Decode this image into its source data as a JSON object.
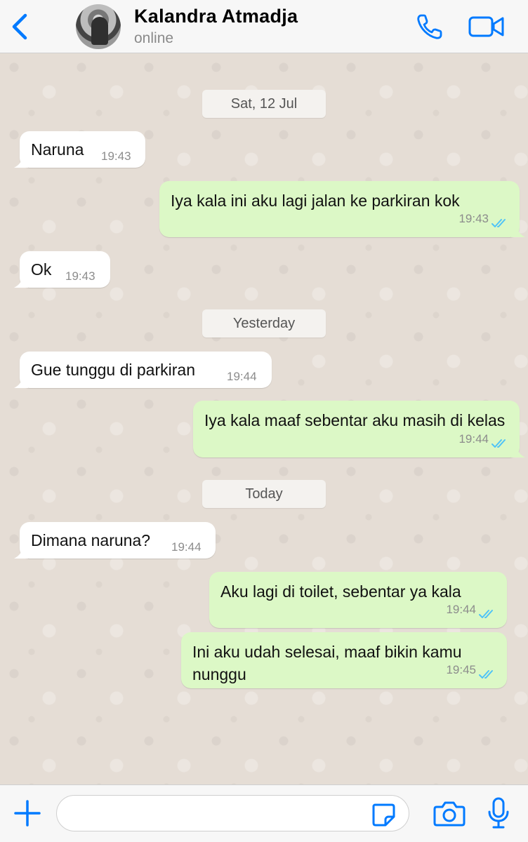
{
  "header": {
    "contact_name": "Kalandra Atmadja",
    "status": "online"
  },
  "colors": {
    "accent": "#007aff",
    "outgoing_bubble": "#dcf8c6",
    "incoming_bubble": "#ffffff",
    "read_ticks": "#4fc3f7",
    "chat_background": "#e5ddd5"
  },
  "icons": {
    "back": "chevron-left-icon",
    "call": "phone-icon",
    "video": "video-camera-icon",
    "attach": "plus-icon",
    "sticker": "sticker-icon",
    "camera": "camera-icon",
    "mic": "microphone-icon",
    "read_receipt": "double-check-icon"
  },
  "chat": {
    "date_separators": [
      "Sat, 12 Jul",
      "Yesterday",
      "Today"
    ],
    "messages": [
      {
        "direction": "incoming",
        "text": "Naruna",
        "time": "19:43"
      },
      {
        "direction": "outgoing",
        "text": "Iya kala ini aku lagi jalan ke parkiran kok",
        "time": "19:43",
        "read": true
      },
      {
        "direction": "incoming",
        "text": "Ok",
        "time": "19:43"
      },
      {
        "direction": "incoming",
        "text": "Gue tunggu di parkiran",
        "time": "19:44"
      },
      {
        "direction": "outgoing",
        "text": "Iya kala maaf sebentar aku masih di kelas",
        "time": "19:44",
        "read": true
      },
      {
        "direction": "incoming",
        "text": "Dimana naruna?",
        "time": "19:44"
      },
      {
        "direction": "outgoing",
        "text": "Aku lagi di toilet, sebentar ya kala",
        "time": "19:44",
        "read": true
      },
      {
        "direction": "outgoing",
        "text": "Ini aku udah selesai, maaf bikin kamu nunggu",
        "time": "19:45",
        "read": true
      }
    ]
  },
  "composer": {
    "value": "",
    "placeholder": ""
  }
}
